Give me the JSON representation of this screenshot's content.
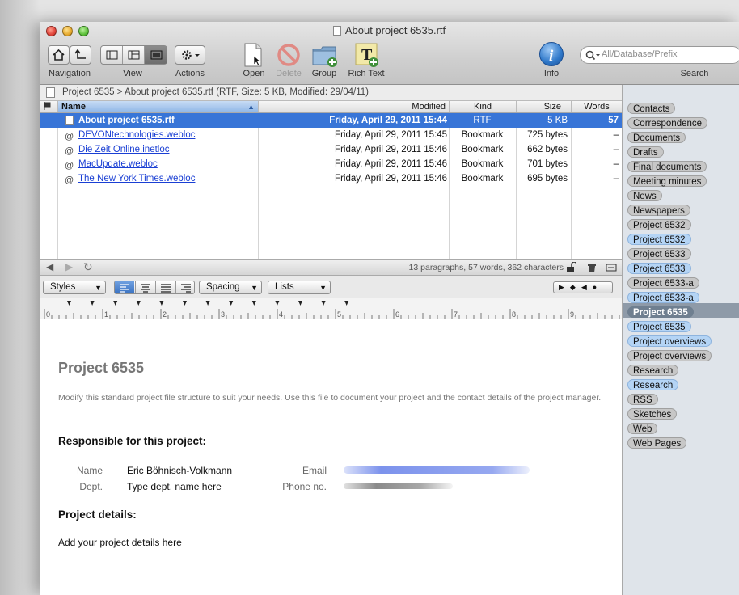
{
  "window": {
    "title": "About project 6535.rtf"
  },
  "toolbar": {
    "navigation_label": "Navigation",
    "view_label": "View",
    "actions_label": "Actions",
    "open_label": "Open",
    "delete_label": "Delete",
    "group_label": "Group",
    "richtext_label": "Rich Text",
    "info_label": "Info",
    "search_label": "Search",
    "search_placeholder": "All/Database/Prefix"
  },
  "pathbar": {
    "text": "Project 6535 > About project 6535.rtf (RTF, Size: 5 KB, Modified: 29/04/11)"
  },
  "list": {
    "columns": {
      "name": "Name",
      "modified": "Modified",
      "kind": "Kind",
      "size": "Size",
      "words": "Words"
    },
    "rows": [
      {
        "name": "About project 6535.rtf",
        "modified": "Friday, April 29, 2011 15:44",
        "kind": "RTF",
        "size": "5 KB",
        "words": "57"
      },
      {
        "name": "DEVONtechnologies.webloc",
        "modified": "Friday, April 29, 2011 15:45",
        "kind": "Bookmark",
        "size": "725 bytes",
        "words": "–"
      },
      {
        "name": "Die Zeit Online.inetloc",
        "modified": "Friday, April 29, 2011 15:46",
        "kind": "Bookmark",
        "size": "662 bytes",
        "words": "–"
      },
      {
        "name": "MacUpdate.webloc",
        "modified": "Friday, April 29, 2011 15:46",
        "kind": "Bookmark",
        "size": "701 bytes",
        "words": "–"
      },
      {
        "name": "The New York Times.webloc",
        "modified": "Friday, April 29, 2011 15:46",
        "kind": "Bookmark",
        "size": "695 bytes",
        "words": "–"
      }
    ]
  },
  "status": {
    "text": "13 paragraphs, 57 words, 362 characters"
  },
  "format": {
    "styles": "Styles",
    "spacing": "Spacing",
    "lists": "Lists"
  },
  "ruler": {
    "ticks": [
      "0",
      "1",
      "2",
      "3",
      "4",
      "5",
      "6",
      "7",
      "8",
      "9"
    ]
  },
  "doc": {
    "title": "Project 6535",
    "intro": "Modify this standard project file structure to suit your needs. Use this file to document your project and the contact details of the project manager.",
    "responsible_heading": "Responsible for this project:",
    "name_label": "Name",
    "name_value": "Eric Böhnisch-Volkmann",
    "dept_label": "Dept.",
    "dept_value": "Type dept. name here",
    "email_label": "Email",
    "phone_label": "Phone no.",
    "details_heading": "Project details:",
    "details_text": "Add your project details here"
  },
  "tags": [
    {
      "label": "Contacts",
      "style": "gray"
    },
    {
      "label": "Correspondence",
      "style": "gray"
    },
    {
      "label": "Documents",
      "style": "gray"
    },
    {
      "label": "Drafts",
      "style": "gray"
    },
    {
      "label": "Final documents",
      "style": "gray"
    },
    {
      "label": "Meeting minutes",
      "style": "gray"
    },
    {
      "label": "News",
      "style": "gray"
    },
    {
      "label": "Newspapers",
      "style": "gray"
    },
    {
      "label": "Project 6532",
      "style": "gray"
    },
    {
      "label": "Project 6532",
      "style": "blue"
    },
    {
      "label": "Project 6533",
      "style": "gray"
    },
    {
      "label": "Project 6533",
      "style": "blue"
    },
    {
      "label": "Project 6533-a",
      "style": "gray"
    },
    {
      "label": "Project 6533-a",
      "style": "blue"
    },
    {
      "label": "Project 6535",
      "style": "selected"
    },
    {
      "label": "Project 6535",
      "style": "blue"
    },
    {
      "label": "Project overviews",
      "style": "blue"
    },
    {
      "label": "Project overviews",
      "style": "gray"
    },
    {
      "label": "Research",
      "style": "gray"
    },
    {
      "label": "Research",
      "style": "blue"
    },
    {
      "label": "RSS",
      "style": "gray"
    },
    {
      "label": "Sketches",
      "style": "gray"
    },
    {
      "label": "Web",
      "style": "gray"
    },
    {
      "label": "Web Pages",
      "style": "gray"
    }
  ]
}
